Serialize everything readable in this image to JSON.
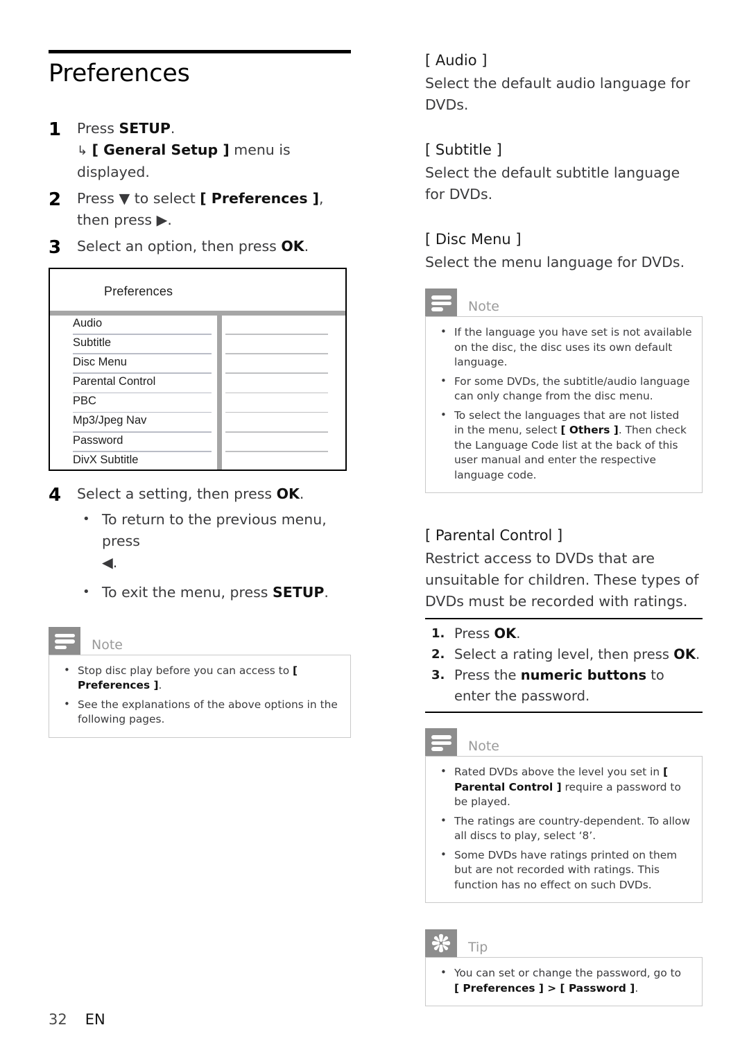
{
  "page": {
    "title": "Preferences",
    "footer_page_number": "32",
    "footer_language": "EN"
  },
  "colors": {
    "callout_tab": "#8d8d8d",
    "callout_label": "#9a9a9a",
    "osd_divider": "#a6a6a6",
    "rule_black": "#000000"
  },
  "steps": [
    {
      "number": "1",
      "text": "Press ",
      "bold": "SETUP",
      "tail": ".",
      "result_arrow": "↳",
      "result_pre": " ",
      "result_bold": "[ General Setup ]",
      "result_post": " menu is displayed."
    },
    {
      "number": "2",
      "pre": "Press ",
      "glyph": "▼",
      "mid": " to select ",
      "bold": "[ Preferences ]",
      "post": ", then press ",
      "glyph2": "▶",
      "tail": "."
    },
    {
      "number": "3",
      "text": "Select an option, then press ",
      "bold": "OK",
      "tail": "."
    },
    {
      "number": "4",
      "text": "Select a setting, then press ",
      "bold": "OK",
      "tail": "."
    }
  ],
  "step4_bullets": [
    {
      "pre": "To return to the previous menu, press ",
      "glyph": "◀",
      "post": "."
    },
    {
      "pre": "To exit the menu, press ",
      "bold": "SETUP",
      "post": "."
    }
  ],
  "osd_menu": {
    "title": "Preferences",
    "rows": [
      "Audio",
      "Subtitle",
      "Disc Menu",
      "Parental Control",
      "PBC",
      "Mp3/Jpeg Nav",
      "Password",
      "DivX Subtitle"
    ]
  },
  "note_left": {
    "label": "Note",
    "icon": "note-lines-icon",
    "items": [
      {
        "pre": "Stop disc play before you can access to ",
        "bold": "[ Preferences ]",
        "post": "."
      },
      {
        "pre": "See the explanations of the above options in the following pages.",
        "bold": "",
        "post": ""
      }
    ]
  },
  "options": [
    {
      "title": "[ Audio ]",
      "desc": "Select the default audio language for DVDs."
    },
    {
      "title": "[ Subtitle ]",
      "desc": "Select the default subtitle language for DVDs."
    },
    {
      "title": "[ Disc Menu ]",
      "desc": "Select the menu language for DVDs."
    }
  ],
  "note_languages": {
    "label": "Note",
    "icon": "note-lines-icon",
    "items": [
      {
        "pre": "If the language you have set is not available on the disc, the disc uses its own default language.",
        "bold": "",
        "post": ""
      },
      {
        "pre": "For some DVDs, the subtitle/audio language can only change from the disc menu.",
        "bold": "",
        "post": ""
      },
      {
        "pre": "To select the languages that are not listed in the menu, select ",
        "bold": "[ Others ]",
        "post": ". Then check the Language Code list at the back of this user manual and enter the respective language code."
      }
    ]
  },
  "parental_control": {
    "title": "[ Parental Control ]",
    "desc": "Restrict access to DVDs that are unsuitable for children. These types of DVDs must be recorded with ratings.",
    "procedure": [
      {
        "pre": "Press ",
        "bold": "OK",
        "post": "."
      },
      {
        "pre": "Select a rating level, then press ",
        "bold": "OK",
        "post": "."
      },
      {
        "pre": "Press the ",
        "bold": "numeric buttons",
        "post": " to enter the password."
      }
    ]
  },
  "note_parental": {
    "label": "Note",
    "icon": "note-lines-icon",
    "items": [
      {
        "pre": "Rated DVDs above the level you set in ",
        "bold": "[ Parental Control ]",
        "post": " require a password to be played."
      },
      {
        "pre": "The ratings are country-dependent. To allow all discs to play, select ‘8’.",
        "bold": "",
        "post": ""
      },
      {
        "pre": "Some DVDs have ratings printed on them but are not recorded with ratings.  This function has no effect on such DVDs.",
        "bold": "",
        "post": ""
      }
    ]
  },
  "tip_password": {
    "label": "Tip",
    "icon": "starburst-icon",
    "items": [
      {
        "pre": "You can set or change the password, go to ",
        "bold": "[ Preferences ] > [ Password ]",
        "post": "."
      }
    ]
  }
}
